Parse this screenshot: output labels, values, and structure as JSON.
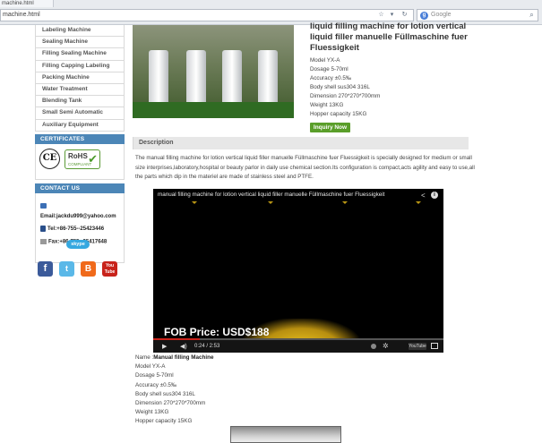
{
  "browser": {
    "tab_fragment": "machine.html",
    "url": "machine.html",
    "search_placeholder": "Google"
  },
  "sidebar": {
    "categories": [
      "Labeling Machine",
      "Sealing Machine",
      "Filling Sealing Machine",
      "Filling Capping Labeling",
      "Packing Machine",
      "Water Treatment",
      "Blending Tank",
      "Small Semi Automatic",
      "Auxiliary Equipment"
    ],
    "certificates_heading": "CERTIFICATES",
    "cert_ce": "CE",
    "cert_rohs": "RoHS",
    "cert_rohs_sub": "COMPLIANT",
    "contact_heading": "CONTACT US",
    "email": "Email:jackdu999@yahoo.com",
    "tel": "Tel:+86-755--25423446",
    "fax": "Fax:+86-755--25417648",
    "skype": "skype"
  },
  "social": {
    "facebook": "f",
    "twitter": "t",
    "blogger": "B",
    "youtube": "You Tube"
  },
  "product": {
    "title": "liquid filling machine for lotion vertical liquid filler manuelle Füllmaschine fuer Fluessigkeit",
    "specs": [
      "Model YX-A",
      "Dosage 5-70ml",
      "Accuracy ±0.5‰",
      "Body shell sus304 316L",
      "Dimension 270*270*700mm",
      "Weight 13KG",
      "Hopper capacity 15KG"
    ],
    "inquiry_label": "Inquiry Now"
  },
  "description": {
    "heading": "Description",
    "text": "The manual filling machine for lotion vertical liquid filler manuelle Füllmaschine fuer Fluessigkeit is specially designed for medium or small size interprises,laboratory,hospital or beauty parlor in daily use chemical section.Its configuration is compact,acts agility and easy to use,all the parts which dip in the materiel are made of stainless steel and PTFE."
  },
  "video": {
    "title": "manual filling machine for lotion vertical liquid filler manuelle Füllmaschine fuer Fluessigkeit",
    "overlay_text": "FOB Price: USD$188",
    "time": "0:24 / 2:53",
    "progress_fraction": 0.16,
    "youtube_label": "YouTube"
  },
  "details": {
    "name_label": "Name :",
    "name_value": "Manual filling Machine",
    "lines": [
      "Model YX-A",
      "Dosage 5-70ml",
      "Accuracy ±0.5‰",
      "Body shell sus304 316L",
      "Dimension 270*270*700mm",
      "Weight 13KG",
      "Hopper capacity 15KG"
    ]
  },
  "colors": {
    "sidebar_header": "#4c86b7",
    "inquiry_button": "#5a9e2a",
    "video_progress": "#c8231b"
  }
}
